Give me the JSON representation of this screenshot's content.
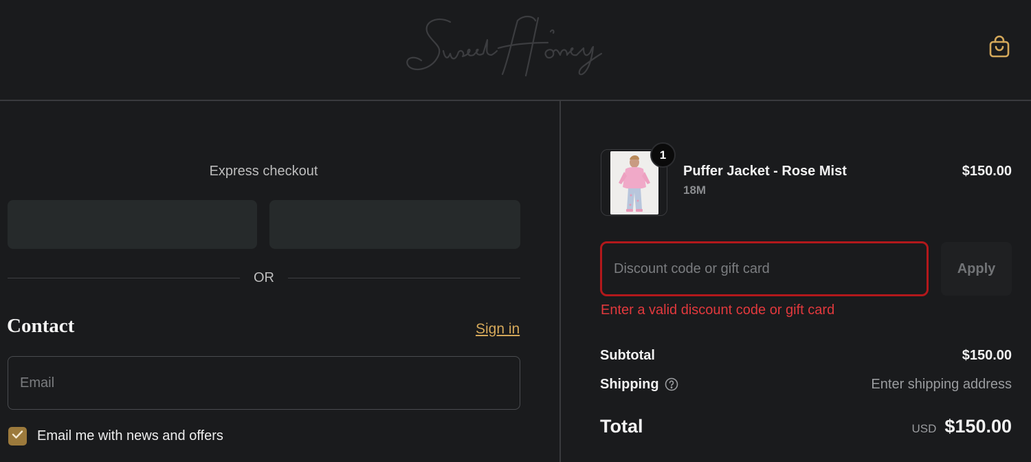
{
  "header": {
    "logo_text": "Sweet Honey",
    "cart_icon": "shopping-bag-icon",
    "accent_color": "#d4a85a"
  },
  "express": {
    "title": "Express checkout",
    "or_label": "OR"
  },
  "contact": {
    "title": "Contact",
    "sign_in": "Sign in",
    "email_placeholder": "Email",
    "email_value": "",
    "newsletter_label": "Email me with news and offers",
    "newsletter_checked": true
  },
  "order": {
    "item": {
      "name": "Puffer Jacket - Rose Mist",
      "variant": "18M",
      "price": "$150.00",
      "quantity": "1"
    },
    "discount": {
      "placeholder": "Discount code or gift card",
      "apply_label": "Apply",
      "error": "Enter a valid discount code or gift card",
      "error_color": "#e2393d"
    },
    "summary": {
      "subtotal_label": "Subtotal",
      "subtotal_value": "$150.00",
      "shipping_label": "Shipping",
      "shipping_value": "Enter shipping address",
      "total_label": "Total",
      "currency": "USD",
      "total_value": "$150.00"
    }
  }
}
